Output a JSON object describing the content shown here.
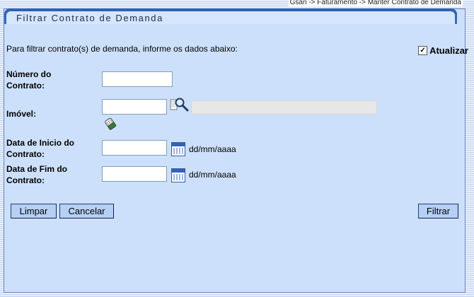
{
  "breadcrumb": "Gsan -> Faturamento -> Manter Contrato de Demanda",
  "panel": {
    "title": "Filtrar Contrato de Demanda"
  },
  "form": {
    "intro": "Para filtrar contrato(s) de demanda, informe os dados abaixo:",
    "atualizar": {
      "label": "Atualizar",
      "checked": true,
      "mark": "✓"
    },
    "numero_contrato": {
      "label_line1": "Número do",
      "label_line2": "Contrato:",
      "value": ""
    },
    "imovel": {
      "label": "Imóvel:",
      "value": "",
      "description": ""
    },
    "data_inicio": {
      "label_line1": "Data de Inicio do",
      "label_line2": "Contrato:",
      "value": "",
      "format": "dd/mm/aaaa"
    },
    "data_fim": {
      "label_line1": "Data de Fim do",
      "label_line2": "Contrato:",
      "value": "",
      "format": "dd/mm/aaaa"
    }
  },
  "buttons": {
    "limpar": "Limpar",
    "cancelar": "Cancelar",
    "filtrar": "Filtrar"
  },
  "icons": {
    "search": "magnifier-icon",
    "eraser": "eraser-icon",
    "calendar": "calendar-icon"
  },
  "colors": {
    "panel_bg": "#cde0fb",
    "title_bar": "#2f5fb0",
    "button_bg": "#b6d0f5"
  }
}
